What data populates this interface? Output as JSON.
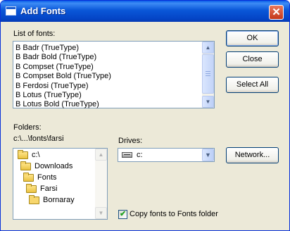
{
  "window": {
    "title": "Add Fonts",
    "close_glyph": "✕"
  },
  "font_list": {
    "label": "List of fonts:",
    "items": [
      "B Badr (TrueType)",
      "B Badr Bold (TrueType)",
      "B Compset (TrueType)",
      "B Compset Bold (TrueType)",
      "B Ferdosi (TrueType)",
      "B Lotus (TrueType)",
      "B Lotus Bold (TrueType)"
    ]
  },
  "buttons": {
    "ok": "OK",
    "close": "Close",
    "select_all": "Select All",
    "network": "Network..."
  },
  "folders": {
    "label": "Folders:",
    "current_path": "c:\\...\\fonts\\farsi",
    "tree": [
      "c:\\",
      "Downloads",
      "Fonts",
      "Farsi",
      "Bornaray"
    ]
  },
  "drives": {
    "label": "Drives:",
    "selected": "c:"
  },
  "copy_option": {
    "label": "Copy fonts to Fonts folder",
    "checked": true
  },
  "scroll_arrows": {
    "up": "▲",
    "down": "▼"
  },
  "icons": {
    "title": "window-icon",
    "folder": "folder-icon",
    "drive": "hard-drive-icon",
    "check": "checkmark-icon"
  },
  "colors": {
    "titlebar": "#0a57d8",
    "dialog_bg": "#ece9d8",
    "close_button": "#c4381a",
    "list_border": "#7f9db9"
  }
}
